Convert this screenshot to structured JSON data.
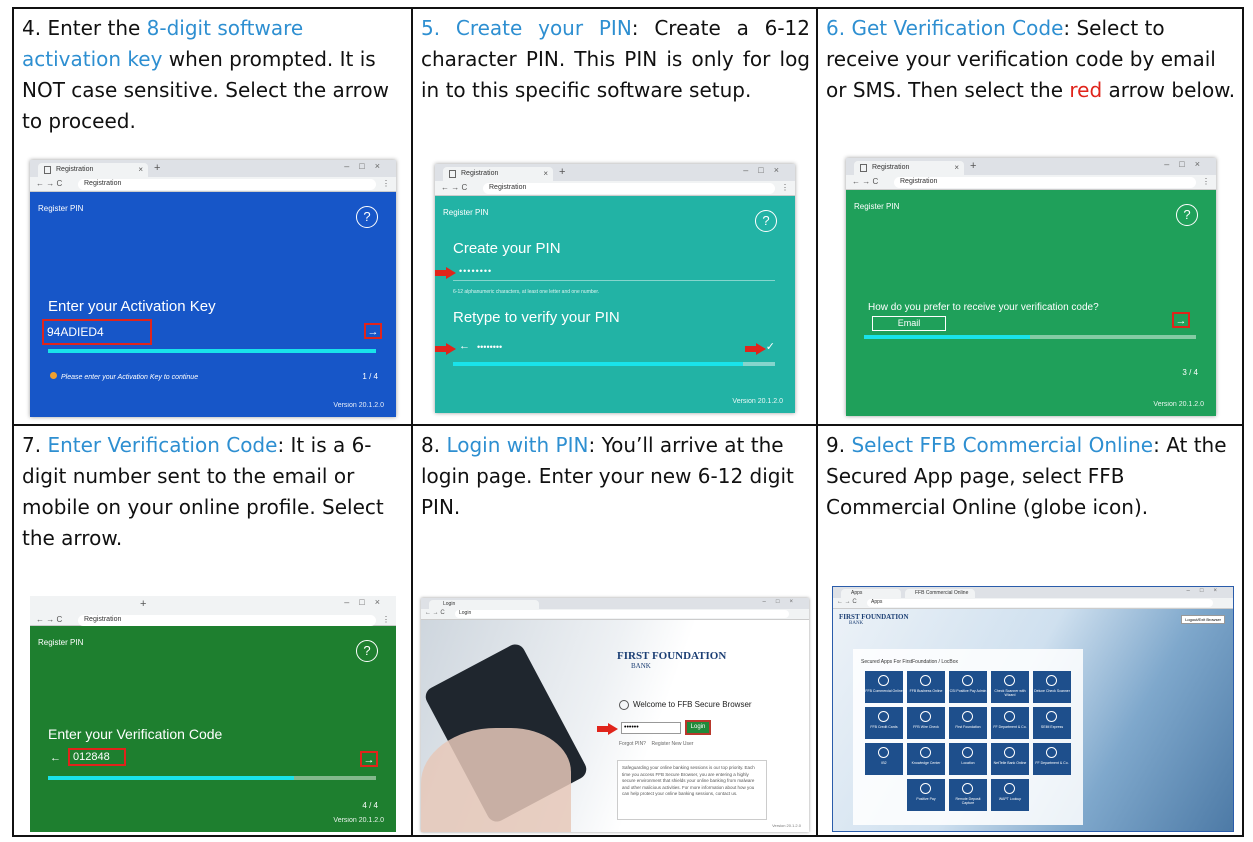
{
  "cells": {
    "s4": {
      "num": "4. Enter the ",
      "link": "8-digit software activation key",
      "rest": " when prompted. It is NOT case sensitive. Select the arrow to proceed.",
      "shot": {
        "tab": "Registration",
        "url": "Registration",
        "panel_title": "Register PIN",
        "help": "?",
        "heading": "Enter your Activation Key",
        "value": "94ADIED4",
        "arrow": "→",
        "note": "Please enter your Activation Key to continue",
        "step": "1 / 4",
        "version": "Version 20.1.2.0",
        "progress": 1.0
      }
    },
    "s5": {
      "link": "5. Create your PIN",
      "rest": ": Create a 6-12 character PIN. This PIN is only for log in to this specific software setup.",
      "shot": {
        "tab": "Registration",
        "url": "Registration",
        "panel_title": "Register PIN",
        "help": "?",
        "heading": "Create your PIN",
        "pin": "••••••••",
        "hint": "6-12 alphanumeric characters, at least one letter and one number.",
        "heading2": "Retype to verify your PIN",
        "back": "←",
        "pin2": "••••••••",
        "check": "✓",
        "version": "Version 20.1.2.0",
        "progress": 0.9
      }
    },
    "s6": {
      "link": "6. Get Verification Code",
      "rest": ": Select to receive your verification code by email or SMS. Then select the ",
      "red": "red",
      "rest2": " arrow below.",
      "shot": {
        "tab": "Registration",
        "url": "Registration",
        "panel_title": "Register PIN",
        "help": "?",
        "heading": "How do you prefer to receive your verification code?",
        "option": "Email",
        "arrow": "→",
        "step": "3 / 4",
        "version": "Version 20.1.2.0",
        "progress": 0.5
      }
    },
    "s7": {
      "num": "7. ",
      "link": "Enter Verification Code",
      "rest": ": It is a 6-digit number sent to the email or mobile on your online profile. Select the arrow.",
      "shot": {
        "url": "Registration",
        "panel_title": "Register PIN",
        "help": "?",
        "heading": "Enter your Verification Code",
        "back": "←",
        "value": "012848",
        "arrow": "→",
        "step": "4 / 4",
        "version": "Version 20.1.2.0",
        "progress": 0.75
      }
    },
    "s8": {
      "num": "8. ",
      "link": "Login with PIN",
      "rest": ": You’ll arrive at the login page. Enter your new 6-12 digit PIN.",
      "shot": {
        "tab": "Login",
        "url": "Login",
        "brand": "FIRST FOUNDATION",
        "brand2": "BANK",
        "welcome": "Welcome to FFB Secure Browser",
        "pin": "••••••",
        "login": "Login",
        "links": "Forgot PIN?    Register New User",
        "info": "Safeguarding your online banking sessions is our top priority. Each time you access FFB Secure Browser, you are entering a highly secure environment that shields your online banking from malware and other malicious activities. For more information about how you can help protect your online banking sessions, contact us.",
        "version": "Version 20.1.2.0"
      }
    },
    "s9": {
      "num": "9. ",
      "link": "Select FFB Commercial Online",
      "rest": ": At the Secured App page, select FFB Commercial Online (globe icon).",
      "shot": {
        "tab": "Apps",
        "tab2": "FFB Commercial Online",
        "url": "Apps",
        "brand": "FIRST FOUNDATION",
        "brand2": "BANK",
        "logout": "Logout/Exit Browser",
        "header": "Secured Apps For FirstFoundation / LocBox",
        "tiles": [
          "FFB Commercial Online",
          "FFB Business Online",
          "CSI Positive Pay Admin",
          "Check Scanner with Wizard",
          "Deluxe Check Scanner",
          "FFB Credit Cards",
          "FFB Wire Check",
          "First Foundation",
          "FF Department & Co.",
          "SEIM Express",
          "IB2",
          "Knowledge Center",
          "Location",
          "NetTelle Bank Online",
          "FF Department & Co.",
          "Positive Pay",
          "Remote Deposit Capture",
          "WAPT Lookup"
        ]
      }
    }
  }
}
